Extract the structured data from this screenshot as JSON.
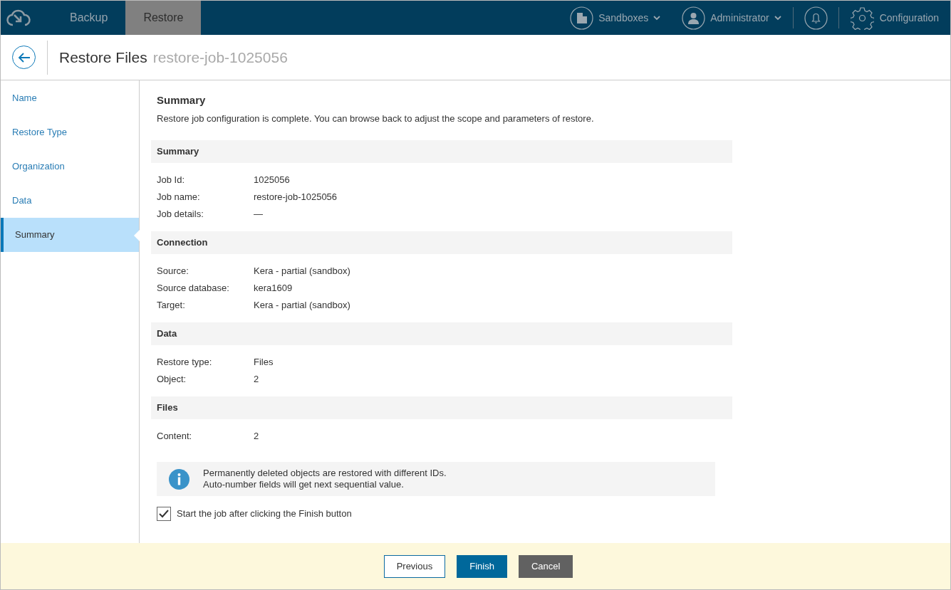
{
  "nav": {
    "tabs": [
      {
        "label": "Backup",
        "selected": false
      },
      {
        "label": "Restore",
        "selected": true
      }
    ],
    "menus": [
      {
        "kind": "sandboxes",
        "label": "Sandboxes"
      },
      {
        "kind": "user",
        "label": "Administrator"
      }
    ],
    "configuration": "Configuration"
  },
  "header": {
    "title": "Restore Files",
    "subtitle": "restore-job-1025056"
  },
  "steps": [
    {
      "label": "Name",
      "selected": false
    },
    {
      "label": "Restore Type",
      "selected": false
    },
    {
      "label": "Organization",
      "selected": false
    },
    {
      "label": "Data",
      "selected": false
    },
    {
      "label": "Summary",
      "selected": true
    }
  ],
  "content": {
    "title": "Summary",
    "description": "Restore job configuration is complete. You can browse back to adjust the scope and parameters of restore.",
    "sections": [
      {
        "title": "Summary",
        "rows": [
          {
            "label": "Job Id:",
            "value": "1025056"
          },
          {
            "label": "Job name:",
            "value": "restore-job-1025056"
          },
          {
            "label": "Job details:",
            "value": "—"
          }
        ]
      },
      {
        "title": "Connection",
        "rows": [
          {
            "label": "Source:",
            "value": "Kera - partial (sandbox)"
          },
          {
            "label": "Source database:",
            "value": "kera1609"
          },
          {
            "label": "Target:",
            "value": "Kera - partial (sandbox)"
          }
        ]
      },
      {
        "title": "Data",
        "rows": [
          {
            "label": "Restore type:",
            "value": "Files"
          },
          {
            "label": "Object:",
            "value": "2"
          }
        ]
      },
      {
        "title": "Files",
        "rows": [
          {
            "label": "Content:",
            "value": "2"
          }
        ]
      }
    ],
    "info": [
      "Permanently deleted objects are restored with different IDs.",
      "Auto-number fields will get next sequential value."
    ],
    "start_job": {
      "label": "Start the job after clicking the Finish button",
      "checked": true
    }
  },
  "footer": {
    "buttons": [
      {
        "kind": "secondary",
        "label": "Previous"
      },
      {
        "kind": "primary",
        "label": "Finish"
      },
      {
        "kind": "cancel",
        "label": "Cancel"
      }
    ]
  }
}
